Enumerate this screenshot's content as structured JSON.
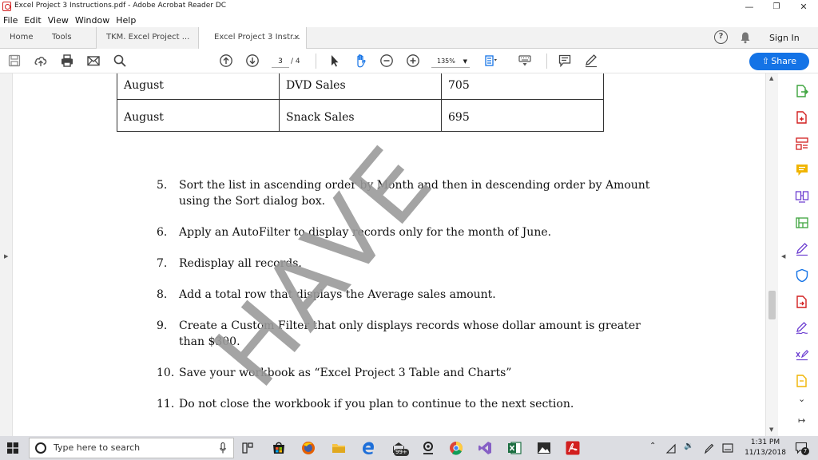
{
  "window": {
    "title": "Excel Project 3 Instructions.pdf - Adobe Acrobat Reader DC",
    "minimize": "—",
    "maximize": "❐",
    "close": "✕"
  },
  "menu": [
    "File",
    "Edit",
    "View",
    "Window",
    "Help"
  ],
  "tabs": {
    "home": "Home",
    "tools": "Tools",
    "doc1": "TKM. Excel Project ...",
    "doc2": "Excel Project 3 Instr...",
    "doc2_close": "×",
    "help": "?",
    "signin": "Sign In"
  },
  "toolbar": {
    "page_current": "3",
    "page_total": "/ 4",
    "zoom": "135%",
    "share": "Share",
    "icons": [
      "save-icon",
      "cloud-upload-icon",
      "print-icon",
      "email-icon",
      "search-icon",
      "page-up-icon",
      "page-down-icon",
      "select-cursor-icon",
      "hand-icon",
      "zoom-out-icon",
      "zoom-in-icon",
      "fit-page-icon",
      "keyboard-icon",
      "comment-icon",
      "sign-icon"
    ]
  },
  "document": {
    "table": [
      [
        "August",
        "DVD Sales",
        "705"
      ],
      [
        "August",
        "Snack Sales",
        "695"
      ]
    ],
    "steps": [
      {
        "num": "5.",
        "text": "Sort the list in ascending order by Month and then in descending order by Amount using the Sort dialog box."
      },
      {
        "num": "6.",
        "text": "Apply an AutoFilter to display records only for the month of June."
      },
      {
        "num": "7.",
        "text": "Redisplay all records."
      },
      {
        "num": "8.",
        "text": "Add a total row that displays the Average sales amount."
      },
      {
        "num": "9.",
        "text": "Create a Custom Filter that only displays records whose dollar amount is greater than $300."
      },
      {
        "num": "10.",
        "text": "Save your workbook as “Excel Project 3 Table and Charts”"
      },
      {
        "num": "11.",
        "text": "Do not close the workbook if you plan to continue to the next section."
      }
    ],
    "watermark": "HAVE"
  },
  "right_panel_icons": [
    "export-pdf-icon",
    "create-pdf-icon",
    "organize-pages-icon",
    "comment-tool-icon",
    "combine-files-icon",
    "edit-pdf-icon",
    "fill-sign-icon",
    "protect-icon",
    "send-for-review-icon",
    "send-for-signature-icon",
    "more-tools-icon",
    "stamp-icon"
  ],
  "taskbar": {
    "search_placeholder": "Type here to search",
    "time": "1:31 PM",
    "date": "11/13/2018",
    "badge": "99+",
    "notifications": "7",
    "apps": [
      "task-view-icon",
      "store-icon",
      "firefox-icon",
      "file-explorer-icon",
      "edge-icon",
      "mail-icon",
      "maps-icon",
      "chrome-icon",
      "visual-studio-icon",
      "excel-icon",
      "photos-icon",
      "acrobat-icon"
    ]
  },
  "colors": {
    "accent": "#1473e6",
    "acrobat_red": "#d21f1f",
    "tool_green": "#3ca33c",
    "tool_purple": "#6d3fd1",
    "tool_yellow": "#f0b400",
    "watermark": "#9a9a9a"
  }
}
